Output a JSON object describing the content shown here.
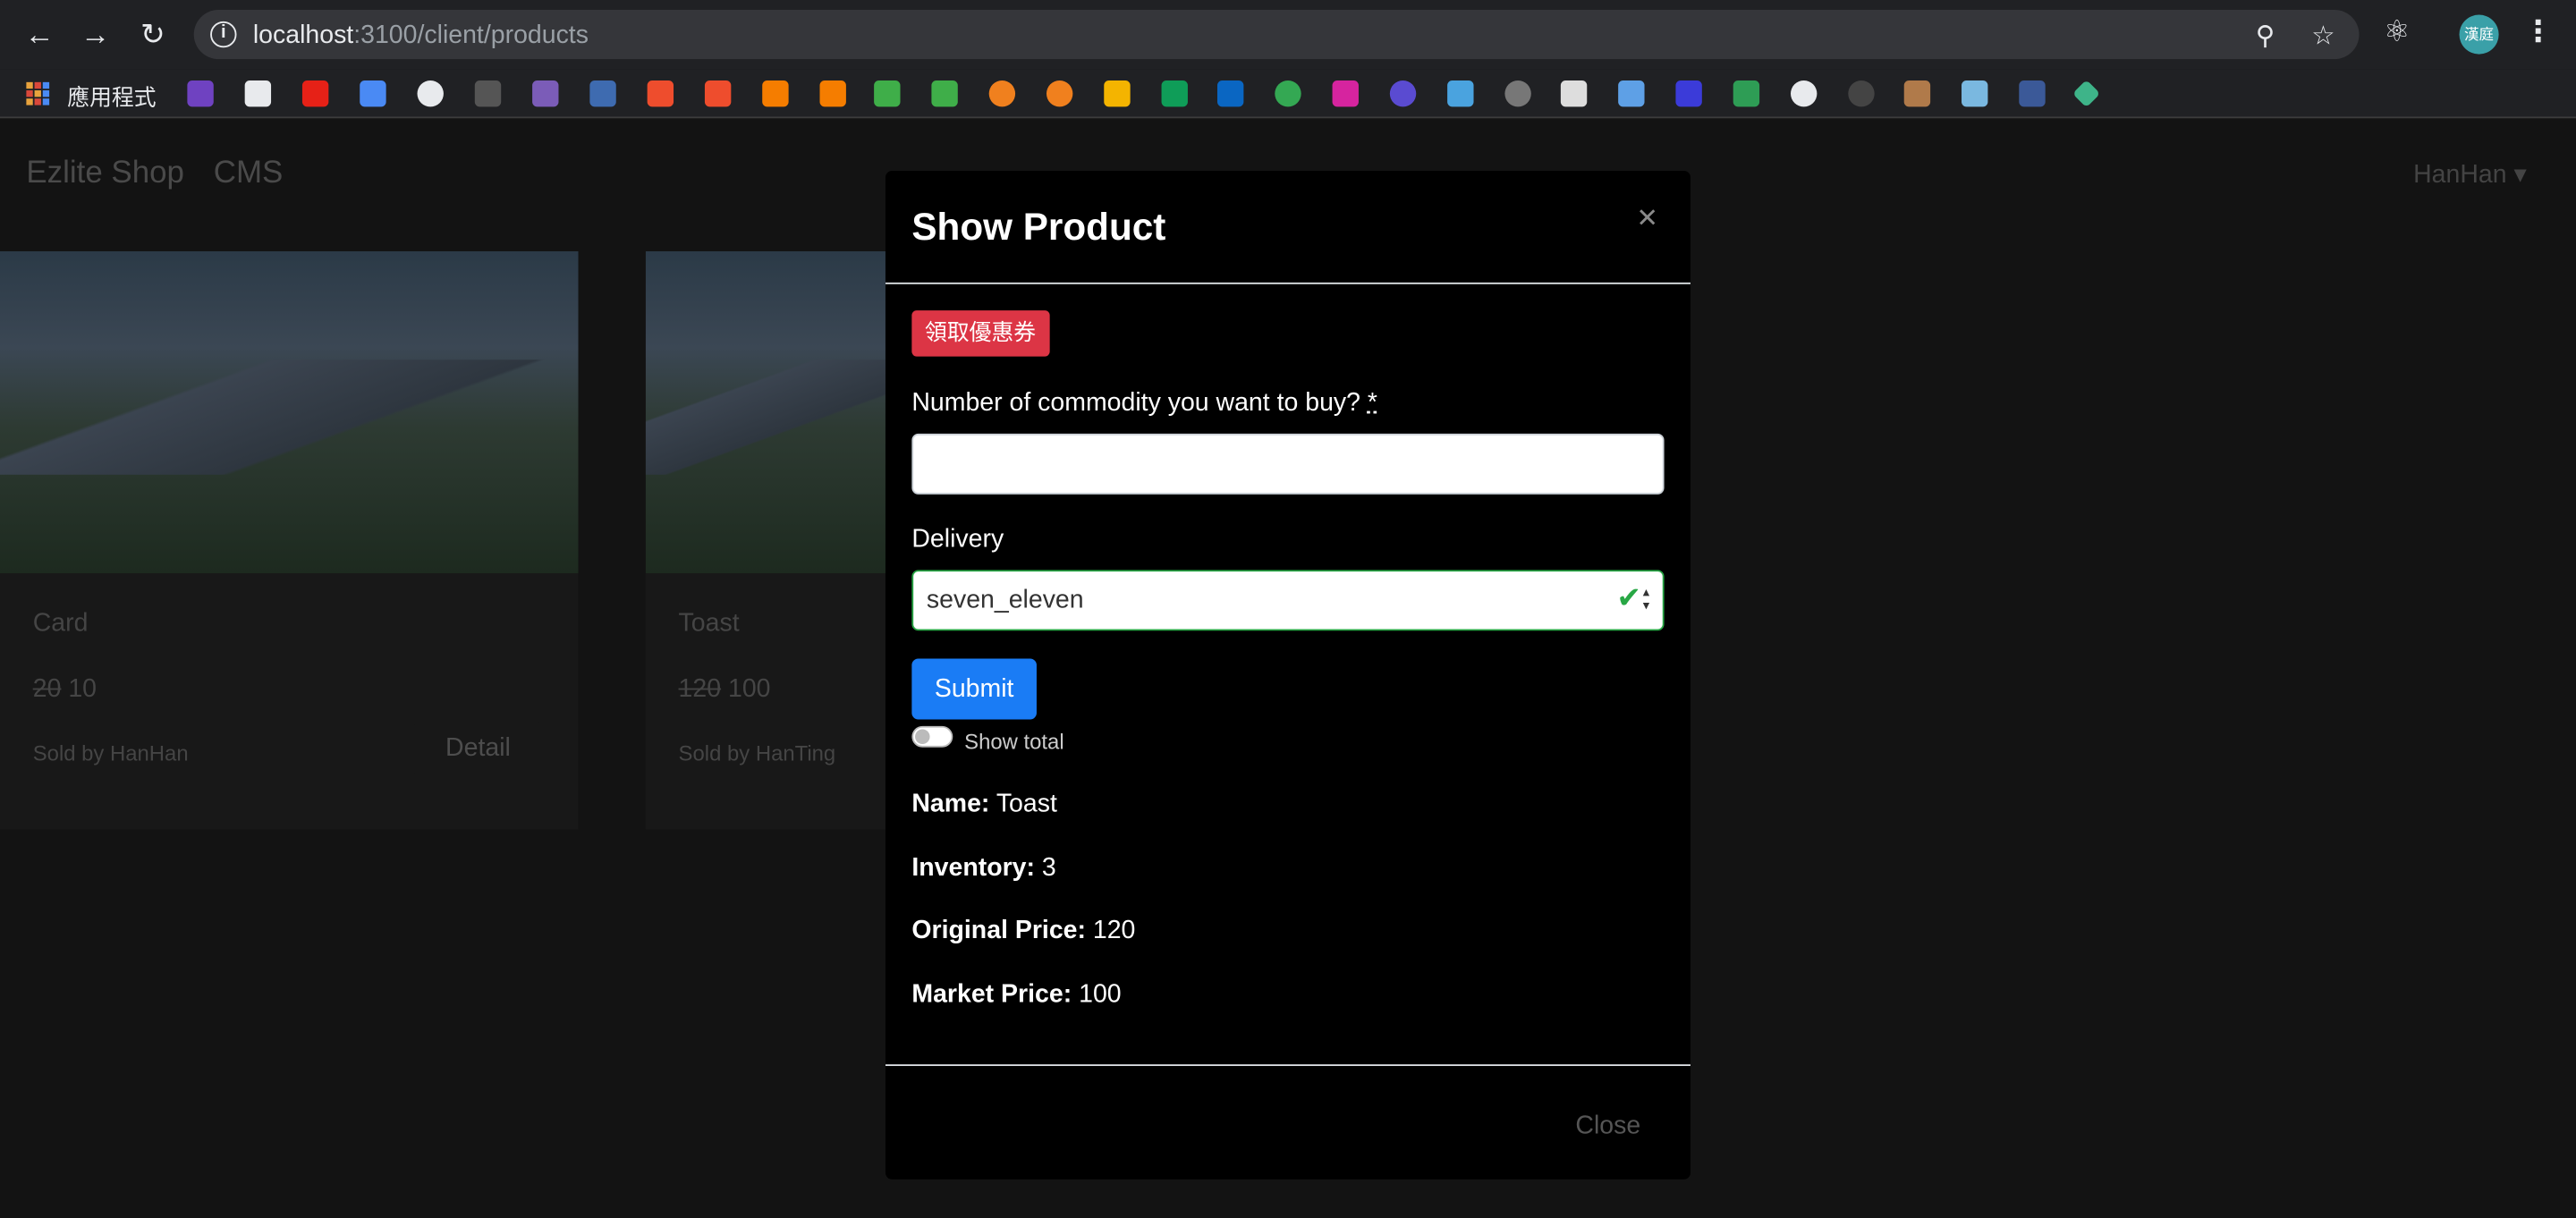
{
  "browser": {
    "url_host": "localhost",
    "url_path": ":3100/client/products",
    "apps_label": "應用程式",
    "avatar_text": "漢庭"
  },
  "page": {
    "brand": "Ezlite Shop",
    "cms": "CMS",
    "user": "HanHan",
    "cards": [
      {
        "title": "Card",
        "original_price": "20",
        "price": "10",
        "seller": "Sold by HanHan",
        "detail": "Detail"
      },
      {
        "title": "Toast",
        "original_price": "120",
        "price": "100",
        "seller": "Sold by HanTing"
      }
    ]
  },
  "modal": {
    "title": "Show Product",
    "coupon_button": "領取優惠券",
    "quantity_label": "Number of commodity you want to buy?",
    "required_mark": "*",
    "delivery_label": "Delivery",
    "delivery_value": "seven_eleven",
    "submit": "Submit",
    "toggle_label": "Show total",
    "info": [
      {
        "label": "Name:",
        "value": "Toast"
      },
      {
        "label": "Inventory:",
        "value": "3"
      },
      {
        "label": "Original Price:",
        "value": "120"
      },
      {
        "label": "Market Price:",
        "value": "100"
      }
    ],
    "close": "Close"
  },
  "colors": {
    "danger": "#dc3545",
    "primary": "#1a7cf5",
    "success": "#28a745"
  }
}
